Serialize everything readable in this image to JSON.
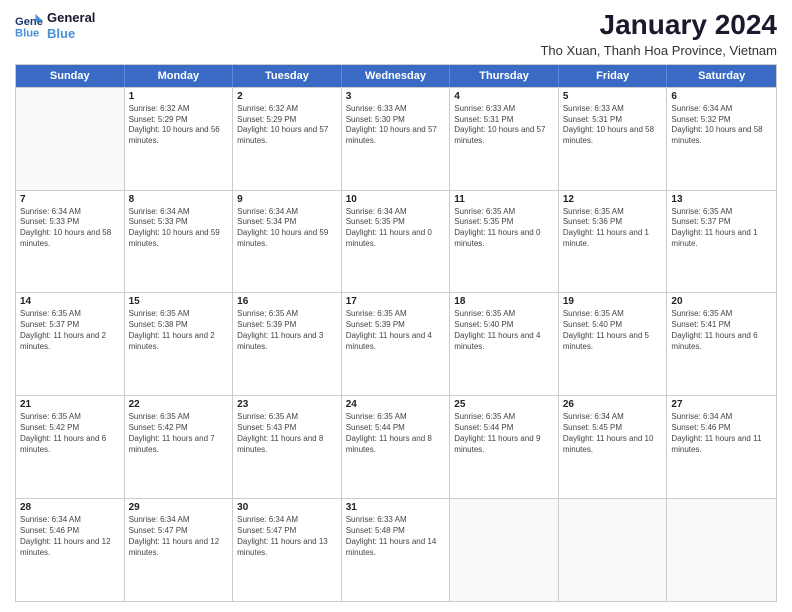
{
  "logo": {
    "line1": "General",
    "line2": "Blue"
  },
  "title": "January 2024",
  "location": "Tho Xuan, Thanh Hoa Province, Vietnam",
  "weekdays": [
    "Sunday",
    "Monday",
    "Tuesday",
    "Wednesday",
    "Thursday",
    "Friday",
    "Saturday"
  ],
  "weeks": [
    [
      {
        "day": "",
        "sunrise": "",
        "sunset": "",
        "daylight": ""
      },
      {
        "day": "1",
        "sunrise": "Sunrise: 6:32 AM",
        "sunset": "Sunset: 5:29 PM",
        "daylight": "Daylight: 10 hours and 56 minutes."
      },
      {
        "day": "2",
        "sunrise": "Sunrise: 6:32 AM",
        "sunset": "Sunset: 5:29 PM",
        "daylight": "Daylight: 10 hours and 57 minutes."
      },
      {
        "day": "3",
        "sunrise": "Sunrise: 6:33 AM",
        "sunset": "Sunset: 5:30 PM",
        "daylight": "Daylight: 10 hours and 57 minutes."
      },
      {
        "day": "4",
        "sunrise": "Sunrise: 6:33 AM",
        "sunset": "Sunset: 5:31 PM",
        "daylight": "Daylight: 10 hours and 57 minutes."
      },
      {
        "day": "5",
        "sunrise": "Sunrise: 6:33 AM",
        "sunset": "Sunset: 5:31 PM",
        "daylight": "Daylight: 10 hours and 58 minutes."
      },
      {
        "day": "6",
        "sunrise": "Sunrise: 6:34 AM",
        "sunset": "Sunset: 5:32 PM",
        "daylight": "Daylight: 10 hours and 58 minutes."
      }
    ],
    [
      {
        "day": "7",
        "sunrise": "Sunrise: 6:34 AM",
        "sunset": "Sunset: 5:33 PM",
        "daylight": "Daylight: 10 hours and 58 minutes."
      },
      {
        "day": "8",
        "sunrise": "Sunrise: 6:34 AM",
        "sunset": "Sunset: 5:33 PM",
        "daylight": "Daylight: 10 hours and 59 minutes."
      },
      {
        "day": "9",
        "sunrise": "Sunrise: 6:34 AM",
        "sunset": "Sunset: 5:34 PM",
        "daylight": "Daylight: 10 hours and 59 minutes."
      },
      {
        "day": "10",
        "sunrise": "Sunrise: 6:34 AM",
        "sunset": "Sunset: 5:35 PM",
        "daylight": "Daylight: 11 hours and 0 minutes."
      },
      {
        "day": "11",
        "sunrise": "Sunrise: 6:35 AM",
        "sunset": "Sunset: 5:35 PM",
        "daylight": "Daylight: 11 hours and 0 minutes."
      },
      {
        "day": "12",
        "sunrise": "Sunrise: 6:35 AM",
        "sunset": "Sunset: 5:36 PM",
        "daylight": "Daylight: 11 hours and 1 minute."
      },
      {
        "day": "13",
        "sunrise": "Sunrise: 6:35 AM",
        "sunset": "Sunset: 5:37 PM",
        "daylight": "Daylight: 11 hours and 1 minute."
      }
    ],
    [
      {
        "day": "14",
        "sunrise": "Sunrise: 6:35 AM",
        "sunset": "Sunset: 5:37 PM",
        "daylight": "Daylight: 11 hours and 2 minutes."
      },
      {
        "day": "15",
        "sunrise": "Sunrise: 6:35 AM",
        "sunset": "Sunset: 5:38 PM",
        "daylight": "Daylight: 11 hours and 2 minutes."
      },
      {
        "day": "16",
        "sunrise": "Sunrise: 6:35 AM",
        "sunset": "Sunset: 5:39 PM",
        "daylight": "Daylight: 11 hours and 3 minutes."
      },
      {
        "day": "17",
        "sunrise": "Sunrise: 6:35 AM",
        "sunset": "Sunset: 5:39 PM",
        "daylight": "Daylight: 11 hours and 4 minutes."
      },
      {
        "day": "18",
        "sunrise": "Sunrise: 6:35 AM",
        "sunset": "Sunset: 5:40 PM",
        "daylight": "Daylight: 11 hours and 4 minutes."
      },
      {
        "day": "19",
        "sunrise": "Sunrise: 6:35 AM",
        "sunset": "Sunset: 5:40 PM",
        "daylight": "Daylight: 11 hours and 5 minutes."
      },
      {
        "day": "20",
        "sunrise": "Sunrise: 6:35 AM",
        "sunset": "Sunset: 5:41 PM",
        "daylight": "Daylight: 11 hours and 6 minutes."
      }
    ],
    [
      {
        "day": "21",
        "sunrise": "Sunrise: 6:35 AM",
        "sunset": "Sunset: 5:42 PM",
        "daylight": "Daylight: 11 hours and 6 minutes."
      },
      {
        "day": "22",
        "sunrise": "Sunrise: 6:35 AM",
        "sunset": "Sunset: 5:42 PM",
        "daylight": "Daylight: 11 hours and 7 minutes."
      },
      {
        "day": "23",
        "sunrise": "Sunrise: 6:35 AM",
        "sunset": "Sunset: 5:43 PM",
        "daylight": "Daylight: 11 hours and 8 minutes."
      },
      {
        "day": "24",
        "sunrise": "Sunrise: 6:35 AM",
        "sunset": "Sunset: 5:44 PM",
        "daylight": "Daylight: 11 hours and 8 minutes."
      },
      {
        "day": "25",
        "sunrise": "Sunrise: 6:35 AM",
        "sunset": "Sunset: 5:44 PM",
        "daylight": "Daylight: 11 hours and 9 minutes."
      },
      {
        "day": "26",
        "sunrise": "Sunrise: 6:34 AM",
        "sunset": "Sunset: 5:45 PM",
        "daylight": "Daylight: 11 hours and 10 minutes."
      },
      {
        "day": "27",
        "sunrise": "Sunrise: 6:34 AM",
        "sunset": "Sunset: 5:46 PM",
        "daylight": "Daylight: 11 hours and 11 minutes."
      }
    ],
    [
      {
        "day": "28",
        "sunrise": "Sunrise: 6:34 AM",
        "sunset": "Sunset: 5:46 PM",
        "daylight": "Daylight: 11 hours and 12 minutes."
      },
      {
        "day": "29",
        "sunrise": "Sunrise: 6:34 AM",
        "sunset": "Sunset: 5:47 PM",
        "daylight": "Daylight: 11 hours and 12 minutes."
      },
      {
        "day": "30",
        "sunrise": "Sunrise: 6:34 AM",
        "sunset": "Sunset: 5:47 PM",
        "daylight": "Daylight: 11 hours and 13 minutes."
      },
      {
        "day": "31",
        "sunrise": "Sunrise: 6:33 AM",
        "sunset": "Sunset: 5:48 PM",
        "daylight": "Daylight: 11 hours and 14 minutes."
      },
      {
        "day": "",
        "sunrise": "",
        "sunset": "",
        "daylight": ""
      },
      {
        "day": "",
        "sunrise": "",
        "sunset": "",
        "daylight": ""
      },
      {
        "day": "",
        "sunrise": "",
        "sunset": "",
        "daylight": ""
      }
    ]
  ]
}
